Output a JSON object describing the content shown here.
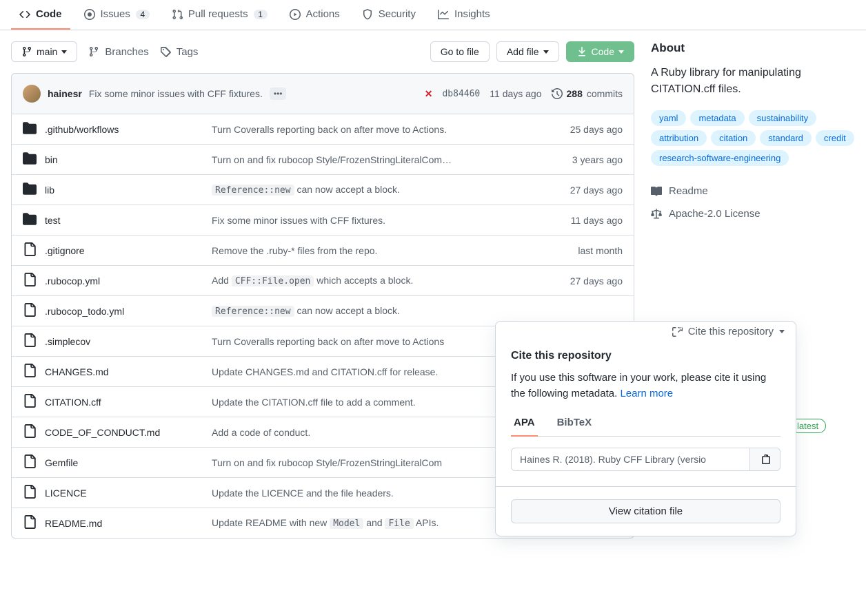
{
  "tabs": [
    {
      "label": "Code",
      "badge": ""
    },
    {
      "label": "Issues",
      "badge": "4"
    },
    {
      "label": "Pull requests",
      "badge": "1"
    },
    {
      "label": "Actions",
      "badge": ""
    },
    {
      "label": "Security",
      "badge": ""
    },
    {
      "label": "Insights",
      "badge": ""
    }
  ],
  "toolbar": {
    "branch": "main",
    "branches": "Branches",
    "tags": "Tags",
    "goto": "Go to file",
    "add": "Add file",
    "code": "Code"
  },
  "commit": {
    "author": "hainesr",
    "message": "Fix some minor issues with CFF fixtures.",
    "hash": "db84460",
    "time": "11 days ago",
    "count": "288",
    "count_label": "commits"
  },
  "files": [
    {
      "type": "dir",
      "name": ".github/workflows",
      "msg": "Turn Coveralls reporting back on after move to Actions.",
      "time": "25 days ago"
    },
    {
      "type": "dir",
      "name": "bin",
      "msg": "Turn on and fix rubocop Style/FrozenStringLiteralCom…",
      "time": "3 years ago"
    },
    {
      "type": "dir",
      "name": "lib",
      "msg_pre": "Reference::new",
      "msg_post": " can now accept a block.",
      "time": "27 days ago"
    },
    {
      "type": "dir",
      "name": "test",
      "msg": "Fix some minor issues with CFF fixtures.",
      "time": "11 days ago"
    },
    {
      "type": "file",
      "name": ".gitignore",
      "msg": "Remove the .ruby-* files from the repo.",
      "time": "last month"
    },
    {
      "type": "file",
      "name": ".rubocop.yml",
      "msg_pre2": "Add ",
      "msg_code": "CFF::File.open",
      "msg_post": " which accepts a block.",
      "time": "27 days ago"
    },
    {
      "type": "file",
      "name": ".rubocop_todo.yml",
      "msg_pre": "Reference::new",
      "msg_post": " can now accept a block.",
      "time": ""
    },
    {
      "type": "file",
      "name": ".simplecov",
      "msg": "Turn Coveralls reporting back on after move to Actions",
      "time": ""
    },
    {
      "type": "file",
      "name": "CHANGES.md",
      "msg": "Update CHANGES.md and CITATION.cff for release.",
      "time": ""
    },
    {
      "type": "file",
      "name": "CITATION.cff",
      "msg": "Update the CITATION.cff file to add a comment.",
      "time": ""
    },
    {
      "type": "file",
      "name": "CODE_OF_CONDUCT.md",
      "msg": "Add a code of conduct.",
      "time": ""
    },
    {
      "type": "file",
      "name": "Gemfile",
      "msg": "Turn on and fix rubocop Style/FrozenStringLiteralCom",
      "time": ""
    },
    {
      "type": "file",
      "name": "LICENCE",
      "msg": "Update the LICENCE and the file headers.",
      "time": ""
    },
    {
      "type": "file",
      "name": "README.md",
      "msg_pre2": "Update README with new ",
      "msg_code": "Model",
      "msg_mid": " and ",
      "msg_code2": "File",
      "msg_post": " APIs.",
      "time": ""
    }
  ],
  "about": {
    "heading": "About",
    "description": "A Ruby library for manipulating CITATION.cff files.",
    "topics": [
      "yaml",
      "metadata",
      "sustainability",
      "attribution",
      "citation",
      "standard",
      "credit",
      "research-software-engineering"
    ],
    "readme": "Readme",
    "license": "Apache-2.0 License",
    "cite": "Cite this repository"
  },
  "popover": {
    "trigger": "Cite this repository",
    "title": "Cite this repository",
    "text": "If you use this software in your work, please cite it using the following metadata. ",
    "learn": "Learn more",
    "tab_apa": "APA",
    "tab_bibtex": "BibTeX",
    "citation": "Haines R. (2018). Ruby CFF Library (versio",
    "view": "View citation file"
  },
  "latest": "latest"
}
